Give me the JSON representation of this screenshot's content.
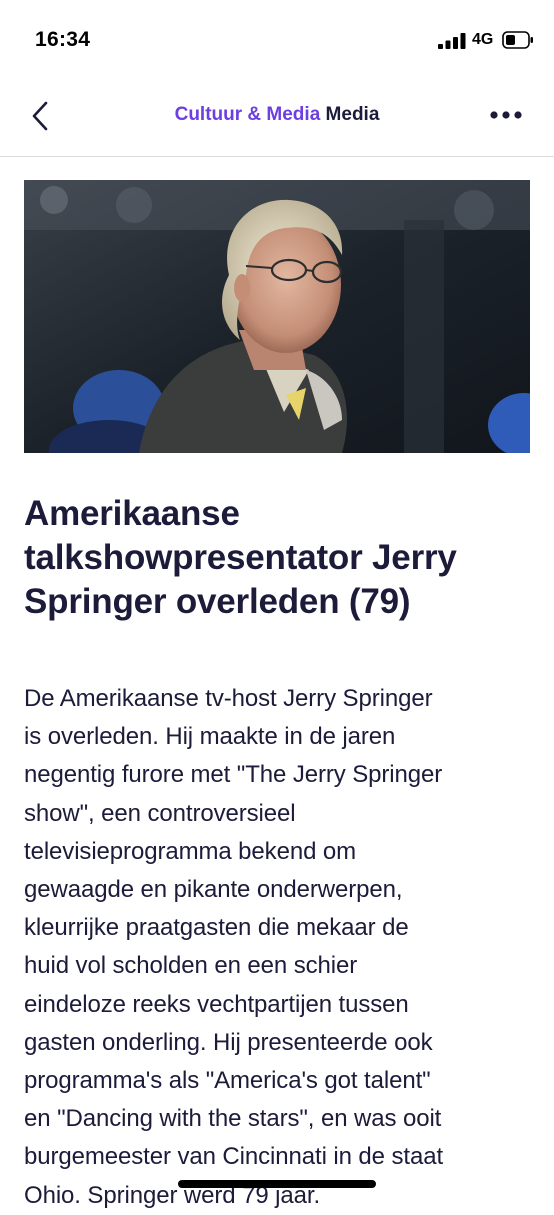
{
  "status_bar": {
    "time": "16:34",
    "network": "4G",
    "icons": [
      "signal-icon",
      "battery-icon"
    ]
  },
  "nav": {
    "back_icon": "chevron-left-icon",
    "section": "Cultuur & Media",
    "subsection": "Media",
    "more_icon": "more-dots-icon",
    "accent_color": "#6c3fe0"
  },
  "article": {
    "image_alt": "Jerry Springer",
    "headline_lines": [
      "Amerikaanse",
      "talkshowpresentator Jerry",
      "Springer overleden (79)"
    ],
    "body_lines": [
      "De Amerikaanse tv-host Jerry Springer",
      "is overleden. Hij maakte in de jaren",
      "negentig furore met \"The Jerry Springer",
      "show\", een controversieel",
      "televisieprogramma bekend om",
      "gewaagde en pikante onderwerpen,",
      "kleurrijke praatgasten die mekaar de",
      "huid vol scholden en een schier",
      "eindeloze reeks vechtpartijen tussen",
      "gasten onderling. Hij presenteerde ook",
      "programma's als \"America's got talent\"",
      "en \"Dancing with the stars\", en was ooit",
      "burgemeester van Cincinnati in de staat",
      "Ohio. Springer werd 79 jaar."
    ],
    "text_color": "#1c1b3a"
  }
}
